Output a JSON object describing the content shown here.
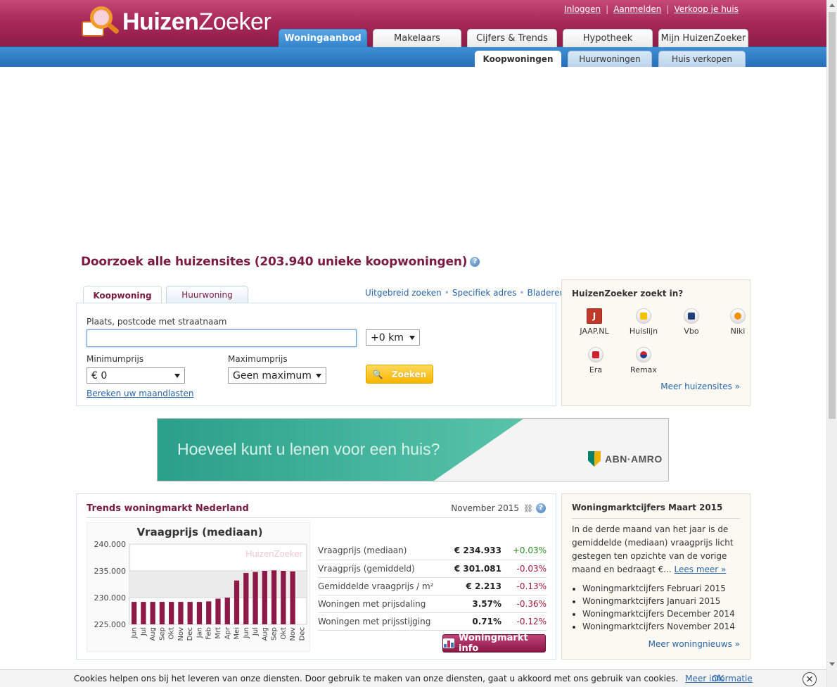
{
  "header": {
    "brand_bold": "Huizen",
    "brand_light": "Zoeker",
    "links": [
      "Inloggen",
      "Aanmelden",
      "Verkoop je huis"
    ],
    "main_tabs": [
      "Woningaanbod",
      "Makelaars",
      "Cijfers & Trends",
      "Hypotheek",
      "Mijn HuizenZoeker"
    ],
    "sub_tabs": [
      "Koopwoningen",
      "Huurwoningen",
      "Huis verkopen"
    ],
    "colors": {
      "header": "#a8295a",
      "subnav": "#2f7ec4"
    }
  },
  "search": {
    "heading": "Doorzoek alle huizensites (203.940 unieke koopwoningen)",
    "tabs": [
      "Koopwoning",
      "Huurwoning"
    ],
    "links": [
      "Uitgebreid zoeken",
      "Specifiek adres",
      "Bladeren"
    ],
    "place_label": "Plaats, postcode met straatnaam",
    "place_value": "",
    "radius_value": "+0 km",
    "min_label": "Minimumprijs",
    "min_value": "€ 0",
    "max_label": "Maximumprijs",
    "max_value": "Geen maximum",
    "search_button": "Zoeken",
    "mortgage_link": "Bereken uw maandlasten"
  },
  "sites_box": {
    "title": "HuizenZoeker zoekt in?",
    "sites": [
      {
        "name": "JAAP.NL",
        "icon": "jaap-icon"
      },
      {
        "name": "Huislijn",
        "icon": "huislijn-icon"
      },
      {
        "name": "Vbo",
        "icon": "vbo-icon"
      },
      {
        "name": "Niki",
        "icon": "niki-icon"
      },
      {
        "name": "Era",
        "icon": "era-icon"
      },
      {
        "name": "Remax",
        "icon": "remax-icon"
      }
    ],
    "more_link": "Meer huizensites »"
  },
  "banner": {
    "text": "Hoeveel kunt u lenen voor een huis?",
    "advertiser": "ABN·AMRO"
  },
  "trends": {
    "title": "Trends woningmarkt Nederland",
    "date": "November 2015",
    "stats": [
      {
        "label": "Vraagprijs (mediaan)",
        "value": "€ 234.933",
        "change": "+0.03%",
        "dir": "up"
      },
      {
        "label": "Vraagprijs (gemiddeld)",
        "value": "€ 301.081",
        "change": "-0.03%",
        "dir": "down"
      },
      {
        "label": "Gemiddelde vraagprijs / m²",
        "value": "€ 2.213",
        "change": "-0.13%",
        "dir": "down"
      },
      {
        "label": "Woningen met prijsdaling",
        "value": "3.57%",
        "change": "-0.36%",
        "dir": "down"
      },
      {
        "label": "Woningen met prijsstijging",
        "value": "0.71%",
        "change": "-0.12%",
        "dir": "down"
      }
    ],
    "button": "Woningmarkt info"
  },
  "chart_data": {
    "type": "bar",
    "title": "Vraagprijs (mediaan)",
    "watermark": "HuizenZoeker",
    "categories": [
      "Jun",
      "Jul",
      "Aug",
      "Sep",
      "Okt",
      "Nov",
      "Dec",
      "Jan",
      "Feb",
      "Mrt",
      "Apr",
      "Mei",
      "Jun",
      "Jul",
      "Aug",
      "Sep",
      "Okt",
      "Nov",
      "Dec"
    ],
    "values": [
      229.2,
      229.2,
      229.2,
      229.2,
      229.2,
      229.2,
      229.2,
      229.2,
      229.3,
      229.8,
      230.0,
      233.2,
      234.6,
      234.8,
      235.0,
      235.1,
      235.0,
      234.9,
      null
    ],
    "yticks": [
      "225.000",
      "230.000",
      "235.000",
      "240.000"
    ],
    "ylim": [
      225,
      240
    ],
    "bar_color": "#8d1a46",
    "grid": true
  },
  "news": {
    "title": "Woningmarktcijfers Maart 2015",
    "body": "In de derde maand van het jaar is de gemiddelde (mediaan) vraagprijs licht gestegen ten opzichte van de vorige maand en bedraagt €...",
    "read_more": "Lees meer »",
    "items": [
      "Woningmarktcijfers Februari 2015",
      "Woningmarktcijfers Januari 2015",
      "Woningmarktcijfers December 2014",
      "Woningmarktcijfers November 2014"
    ],
    "more_link": "Meer woningnieuws »"
  },
  "cookie": {
    "text": "Cookies helpen ons bij het leveren van onze diensten. Door gebruik te maken van onze diensten, gaat u akkoord met ons gebruik van cookies.",
    "more_link": "Meer informatie",
    "ok": "OK",
    "close": "⨯"
  }
}
